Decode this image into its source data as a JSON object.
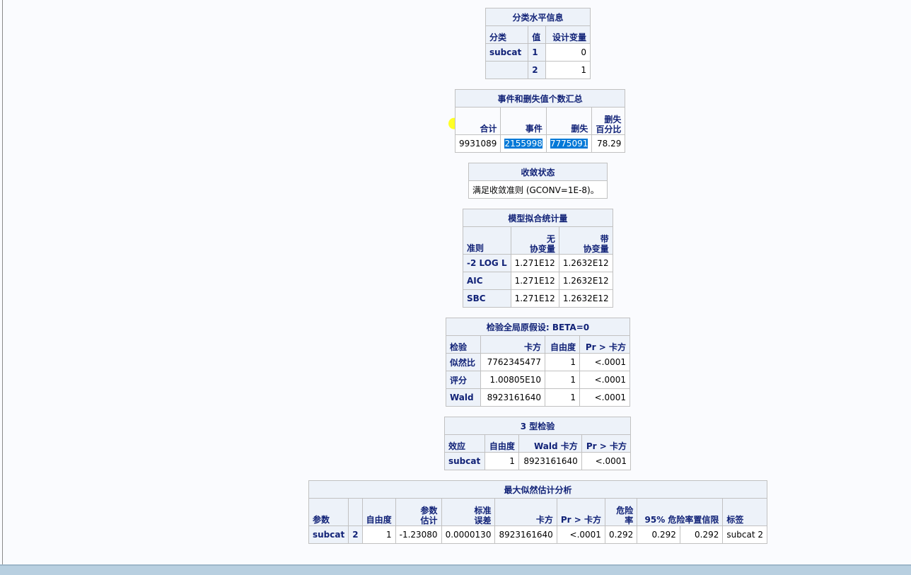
{
  "class_level": {
    "caption": "分类水平信息",
    "headers": [
      "分类",
      "值",
      "设计变量"
    ],
    "rows": [
      [
        "subcat",
        "1",
        "0"
      ],
      [
        "",
        "2",
        "1"
      ]
    ]
  },
  "event_summary": {
    "caption": "事件和删失值个数汇总",
    "headers": [
      "合计",
      "事件",
      "删失",
      "删失",
      "百分比"
    ],
    "values": [
      "9931089",
      "2155998",
      "7775091",
      "78.29"
    ]
  },
  "convergence": {
    "caption": "收敛状态",
    "text": "满足收敛准则 (GCONV=1E-8)。"
  },
  "model_fit": {
    "caption": "模型拟合统计量",
    "headers": [
      "准则",
      "无",
      "协变量",
      "带",
      "协变量"
    ],
    "rows": [
      [
        "-2 LOG L",
        "1.271E12",
        "1.2632E12"
      ],
      [
        "AIC",
        "1.271E12",
        "1.2632E12"
      ],
      [
        "SBC",
        "1.271E12",
        "1.2632E12"
      ]
    ]
  },
  "global_test": {
    "caption": "检验全局原假设: BETA=0",
    "headers": [
      "检验",
      "卡方",
      "自由度",
      "Pr > 卡方"
    ],
    "rows": [
      [
        "似然比",
        "7762345477",
        "1",
        "<.0001"
      ],
      [
        "评分",
        "1.00805E10",
        "1",
        "<.0001"
      ],
      [
        "Wald",
        "8923161640",
        "1",
        "<.0001"
      ]
    ]
  },
  "type3": {
    "caption": "3 型检验",
    "headers": [
      "效应",
      "自由度",
      "Wald 卡方",
      "Pr > 卡方"
    ],
    "rows": [
      [
        "subcat",
        "1",
        "8923161640",
        "<.0001"
      ]
    ]
  },
  "mle": {
    "caption": "最大似然估计分析",
    "headers": [
      "参数",
      "",
      "自由度",
      "参数",
      "估计",
      "标准",
      "误差",
      "卡方",
      "Pr > 卡方",
      "危险",
      "率",
      "95% 危险率置信限",
      "标签"
    ],
    "row": [
      "subcat",
      "2",
      "1",
      "-1.23080",
      "0.0000130",
      "8923161640",
      "<.0001",
      "0.292",
      "0.292",
      "0.292",
      "subcat 2"
    ]
  },
  "colors": {
    "header_bg": "#edf2f9",
    "header_text": "#112277",
    "selection": "#0078d7",
    "highlighter": "#ffff00"
  }
}
